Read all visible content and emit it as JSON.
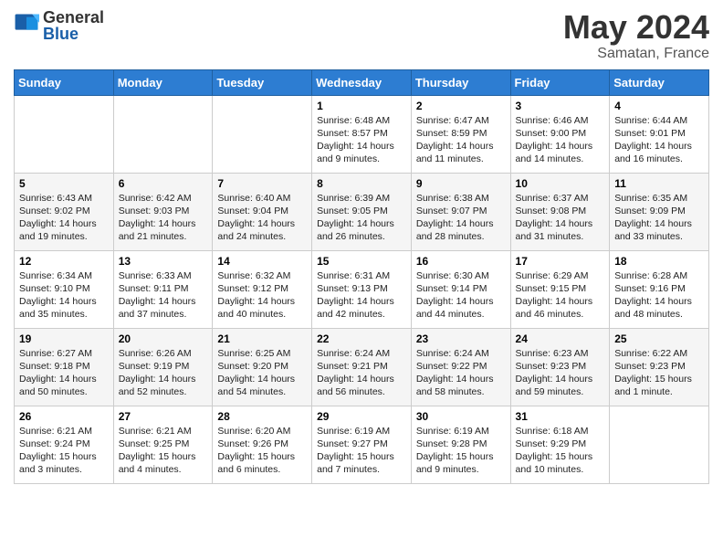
{
  "logo": {
    "general": "General",
    "blue": "Blue"
  },
  "title": {
    "month": "May 2024",
    "location": "Samatan, France"
  },
  "header": {
    "days": [
      "Sunday",
      "Monday",
      "Tuesday",
      "Wednesday",
      "Thursday",
      "Friday",
      "Saturday"
    ]
  },
  "weeks": [
    [
      {
        "day": "",
        "content": ""
      },
      {
        "day": "",
        "content": ""
      },
      {
        "day": "",
        "content": ""
      },
      {
        "day": "1",
        "content": "Sunrise: 6:48 AM\nSunset: 8:57 PM\nDaylight: 14 hours and 9 minutes."
      },
      {
        "day": "2",
        "content": "Sunrise: 6:47 AM\nSunset: 8:59 PM\nDaylight: 14 hours and 11 minutes."
      },
      {
        "day": "3",
        "content": "Sunrise: 6:46 AM\nSunset: 9:00 PM\nDaylight: 14 hours and 14 minutes."
      },
      {
        "day": "4",
        "content": "Sunrise: 6:44 AM\nSunset: 9:01 PM\nDaylight: 14 hours and 16 minutes."
      }
    ],
    [
      {
        "day": "5",
        "content": "Sunrise: 6:43 AM\nSunset: 9:02 PM\nDaylight: 14 hours and 19 minutes."
      },
      {
        "day": "6",
        "content": "Sunrise: 6:42 AM\nSunset: 9:03 PM\nDaylight: 14 hours and 21 minutes."
      },
      {
        "day": "7",
        "content": "Sunrise: 6:40 AM\nSunset: 9:04 PM\nDaylight: 14 hours and 24 minutes."
      },
      {
        "day": "8",
        "content": "Sunrise: 6:39 AM\nSunset: 9:05 PM\nDaylight: 14 hours and 26 minutes."
      },
      {
        "day": "9",
        "content": "Sunrise: 6:38 AM\nSunset: 9:07 PM\nDaylight: 14 hours and 28 minutes."
      },
      {
        "day": "10",
        "content": "Sunrise: 6:37 AM\nSunset: 9:08 PM\nDaylight: 14 hours and 31 minutes."
      },
      {
        "day": "11",
        "content": "Sunrise: 6:35 AM\nSunset: 9:09 PM\nDaylight: 14 hours and 33 minutes."
      }
    ],
    [
      {
        "day": "12",
        "content": "Sunrise: 6:34 AM\nSunset: 9:10 PM\nDaylight: 14 hours and 35 minutes."
      },
      {
        "day": "13",
        "content": "Sunrise: 6:33 AM\nSunset: 9:11 PM\nDaylight: 14 hours and 37 minutes."
      },
      {
        "day": "14",
        "content": "Sunrise: 6:32 AM\nSunset: 9:12 PM\nDaylight: 14 hours and 40 minutes."
      },
      {
        "day": "15",
        "content": "Sunrise: 6:31 AM\nSunset: 9:13 PM\nDaylight: 14 hours and 42 minutes."
      },
      {
        "day": "16",
        "content": "Sunrise: 6:30 AM\nSunset: 9:14 PM\nDaylight: 14 hours and 44 minutes."
      },
      {
        "day": "17",
        "content": "Sunrise: 6:29 AM\nSunset: 9:15 PM\nDaylight: 14 hours and 46 minutes."
      },
      {
        "day": "18",
        "content": "Sunrise: 6:28 AM\nSunset: 9:16 PM\nDaylight: 14 hours and 48 minutes."
      }
    ],
    [
      {
        "day": "19",
        "content": "Sunrise: 6:27 AM\nSunset: 9:18 PM\nDaylight: 14 hours and 50 minutes."
      },
      {
        "day": "20",
        "content": "Sunrise: 6:26 AM\nSunset: 9:19 PM\nDaylight: 14 hours and 52 minutes."
      },
      {
        "day": "21",
        "content": "Sunrise: 6:25 AM\nSunset: 9:20 PM\nDaylight: 14 hours and 54 minutes."
      },
      {
        "day": "22",
        "content": "Sunrise: 6:24 AM\nSunset: 9:21 PM\nDaylight: 14 hours and 56 minutes."
      },
      {
        "day": "23",
        "content": "Sunrise: 6:24 AM\nSunset: 9:22 PM\nDaylight: 14 hours and 58 minutes."
      },
      {
        "day": "24",
        "content": "Sunrise: 6:23 AM\nSunset: 9:23 PM\nDaylight: 14 hours and 59 minutes."
      },
      {
        "day": "25",
        "content": "Sunrise: 6:22 AM\nSunset: 9:23 PM\nDaylight: 15 hours and 1 minute."
      }
    ],
    [
      {
        "day": "26",
        "content": "Sunrise: 6:21 AM\nSunset: 9:24 PM\nDaylight: 15 hours and 3 minutes."
      },
      {
        "day": "27",
        "content": "Sunrise: 6:21 AM\nSunset: 9:25 PM\nDaylight: 15 hours and 4 minutes."
      },
      {
        "day": "28",
        "content": "Sunrise: 6:20 AM\nSunset: 9:26 PM\nDaylight: 15 hours and 6 minutes."
      },
      {
        "day": "29",
        "content": "Sunrise: 6:19 AM\nSunset: 9:27 PM\nDaylight: 15 hours and 7 minutes."
      },
      {
        "day": "30",
        "content": "Sunrise: 6:19 AM\nSunset: 9:28 PM\nDaylight: 15 hours and 9 minutes."
      },
      {
        "day": "31",
        "content": "Sunrise: 6:18 AM\nSunset: 9:29 PM\nDaylight: 15 hours and 10 minutes."
      },
      {
        "day": "",
        "content": ""
      }
    ]
  ]
}
